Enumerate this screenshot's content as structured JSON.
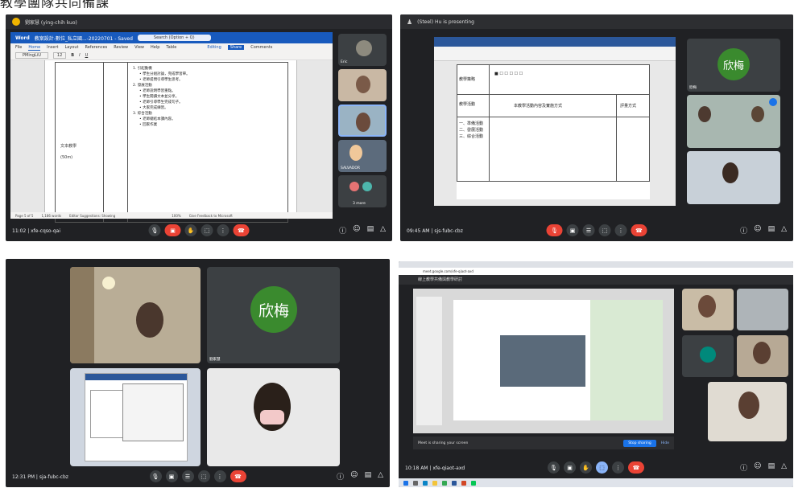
{
  "header_text": "教學團隊共同備課",
  "panel1": {
    "window_title": "劉家慧 (ying-chih kuo)",
    "word": {
      "app": "Word",
      "file_name": "教案設計-數位_私立國...-20220701 - Saved",
      "search_placeholder": "Search (Option + Q)",
      "editing": "Editing",
      "share": "Share",
      "comments": "Comments",
      "tabs": [
        "File",
        "Home",
        "Insert",
        "Layout",
        "References",
        "Review",
        "View",
        "Help",
        "Table"
      ],
      "font": "PMingLiU",
      "size": "12",
      "left_labels": [
        "文本教學",
        "(50m)"
      ],
      "content": [
        "1. 引起動機",
        "• 學生分組討論，完成學習單。",
        "• 老師提問引導學生思考。",
        "2. 發展活動",
        "• 老師說明學習重點。",
        "• 學生閱讀文本並分享。",
        "• 老師引導學生完成句子。",
        "• 大家完成練習。",
        "3. 綜合活動",
        "• 老師總結本課內容。",
        "• 回家作業"
      ],
      "status": [
        "Page 5 of 5",
        "1,186 words",
        "Editor Suggestions: Showing",
        "100%",
        "Give Feedback to Microsoft"
      ]
    },
    "meeting_info": "11:02 | xfe-cqso-qai",
    "participants": [
      "Eric",
      "",
      "",
      "",
      "SALVADOR"
    ],
    "more_label": "3 more"
  },
  "panel2": {
    "window_title": "(Steel) Hu is presenting",
    "avatar_text": "欣梅",
    "tile_names": [
      "欣梅",
      "",
      ""
    ],
    "doc_cells": [
      "教學策略",
      "教學活動",
      "本教學活動內容及實施方式",
      "評量方式",
      "一、準備活動",
      "二、發展活動",
      "三、綜合活動"
    ],
    "meeting_info": "09:45 AM | sjs-fubc-cbz"
  },
  "panel3": {
    "avatar_text": "欣梅",
    "tile_name": "劉家慧",
    "meeting_info": "12:31 PM | sja-fubc-cbz"
  },
  "panel4": {
    "url": "meet.google.com/xfe-qiaot-axd",
    "banner": "線上教學共備與教學研討",
    "meeting_info": "10:18 AM | xfe-qiaot-axd",
    "share_notice": "Meet is sharing your screen",
    "stop_button": "Stop sharing",
    "hide_button": "Hide"
  },
  "colors": {
    "meet_bg": "#202124",
    "end_call": "#ea4335",
    "word_blue": "#185abd",
    "avatar_green": "#3a8a2e"
  }
}
